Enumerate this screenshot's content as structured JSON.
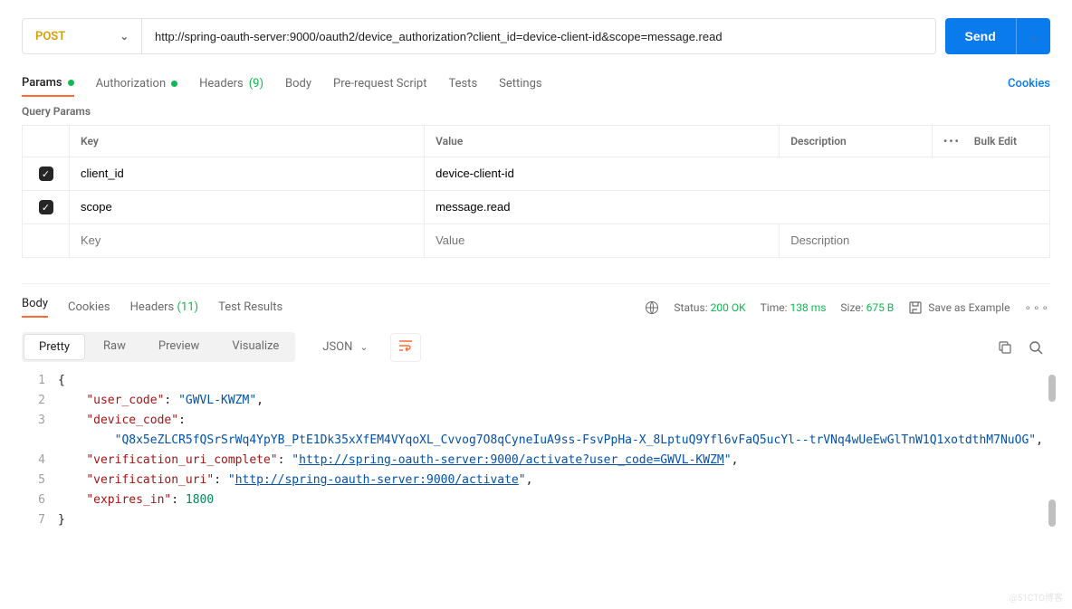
{
  "request": {
    "method": "POST",
    "url": "http://spring-oauth-server:9000/oauth2/device_authorization?client_id=device-client-id&scope=message.read",
    "send_label": "Send"
  },
  "tabs": {
    "params": "Params",
    "authorization": "Authorization",
    "headers": "Headers",
    "headers_count": "(9)",
    "body": "Body",
    "prerequest": "Pre-request Script",
    "tests": "Tests",
    "settings": "Settings",
    "cookies": "Cookies"
  },
  "query_params": {
    "title": "Query Params",
    "headers": {
      "key": "Key",
      "value": "Value",
      "description": "Description",
      "bulk": "Bulk Edit"
    },
    "rows": [
      {
        "key": "client_id",
        "value": "device-client-id"
      },
      {
        "key": "scope",
        "value": "message.read"
      }
    ],
    "placeholders": {
      "key": "Key",
      "value": "Value",
      "description": "Description"
    }
  },
  "response": {
    "tabs": {
      "body": "Body",
      "cookies": "Cookies",
      "headers": "Headers",
      "headers_count": "(11)",
      "tests": "Test Results"
    },
    "status_label": "Status:",
    "status_value": "200 OK",
    "time_label": "Time:",
    "time_value": "138 ms",
    "size_label": "Size:",
    "size_value": "675 B",
    "save_example": "Save as Example",
    "view_tabs": {
      "pretty": "Pretty",
      "raw": "Raw",
      "preview": "Preview",
      "visualize": "Visualize"
    },
    "format": "JSON",
    "body_json": {
      "user_code": "GWVL-KWZM",
      "device_code": "Q8x5eZLCR5fQSrSrWq4YpYB_PtE1Dk35xXfEM4VYqoXL_Cvvog7O8qCyneIuA9ss-FsvPpHa-X_8LptuQ9Yfl6vFaQ5ucYl--trVNq4wUeEwGlTnW1Q1xotdthM7NuOG",
      "verification_uri_complete": "http://spring-oauth-server:9000/activate?user_code=GWVL-KWZM",
      "verification_uri": "http://spring-oauth-server:9000/activate",
      "expires_in": 1800
    }
  },
  "watermark": "@51CTO博客"
}
